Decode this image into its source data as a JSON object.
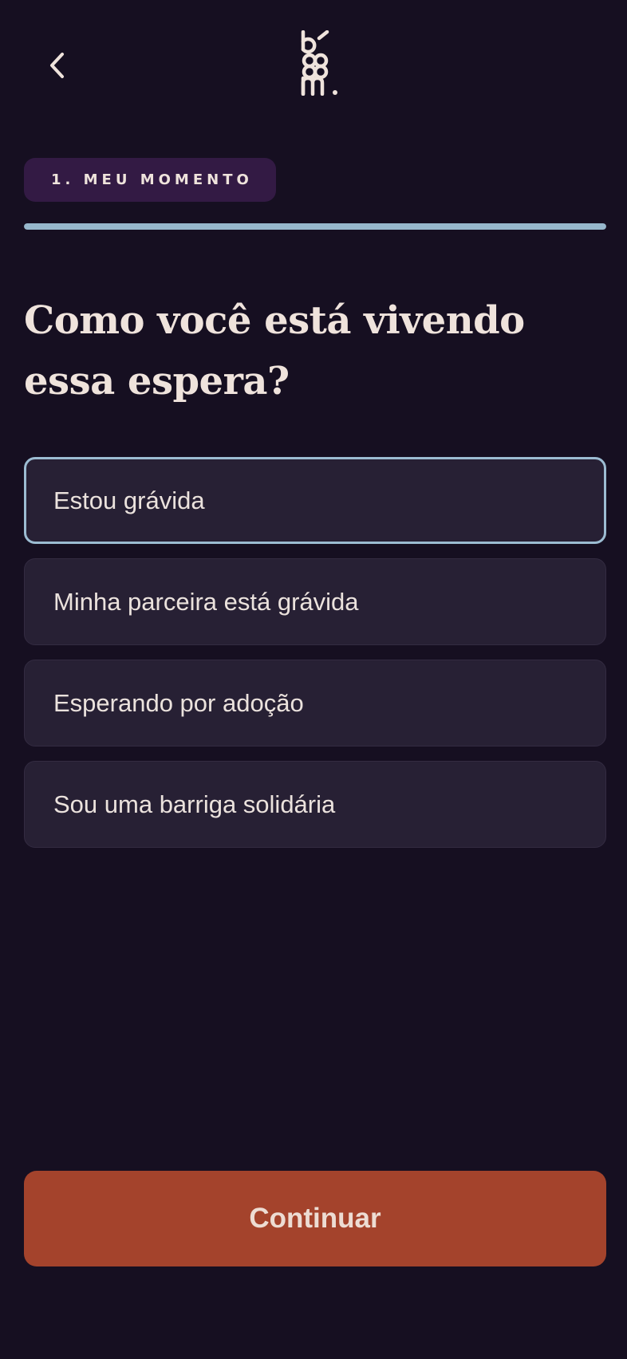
{
  "header": {
    "back_icon": "chevron-left-icon",
    "logo_icon": "bloom-logo-icon"
  },
  "step": {
    "label": "1. MEU MOMENTO",
    "progress": 1.0
  },
  "question": {
    "title": "Como você está vivendo essa espera?"
  },
  "options": [
    {
      "label": "Estou grávida",
      "selected": true
    },
    {
      "label": "Minha parceira está grávida",
      "selected": false
    },
    {
      "label": "Esperando por adoção",
      "selected": false
    },
    {
      "label": "Sou uma barriga solidária",
      "selected": false
    }
  ],
  "footer": {
    "continue_label": "Continuar"
  },
  "colors": {
    "background": "#160f21",
    "option_background": "#272034",
    "selected_border": "#9cbcd2",
    "progress": "#97b7cc",
    "badge": "#331a44",
    "accent_button": "#a4432c",
    "text": "#efe3dc"
  }
}
